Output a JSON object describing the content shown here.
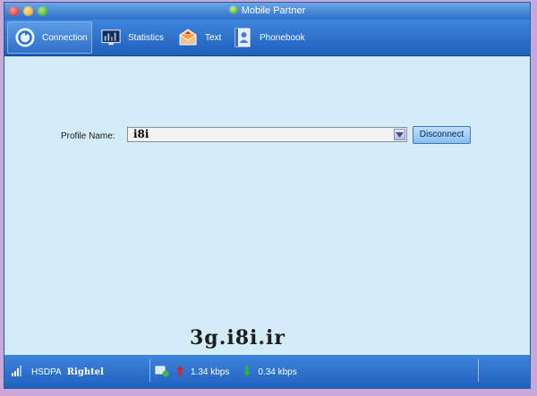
{
  "window": {
    "title": "Mobile Partner"
  },
  "tabs": [
    {
      "label": "Connection",
      "icon": "connection-icon",
      "active": true
    },
    {
      "label": "Statistics",
      "icon": "statistics-icon",
      "active": false
    },
    {
      "label": "Text",
      "icon": "envelope-icon",
      "active": false
    },
    {
      "label": "Phonebook",
      "icon": "phonebook-icon",
      "active": false
    }
  ],
  "connection": {
    "profile_label": "Profile Name:",
    "profile_value": "i8i",
    "disconnect_label": "Disconnect"
  },
  "watermark": "3g.i8i.ir",
  "status": {
    "network_type": "HSDPA",
    "network_name": "Rightel",
    "upload_speed": "1.34 kbps",
    "download_speed": "0.34 kbps"
  },
  "colors": {
    "toolbar": "#2f6fc9",
    "content_bg": "#d4ecf8",
    "upload_arrow": "#e02020",
    "download_arrow": "#2fb52f"
  }
}
